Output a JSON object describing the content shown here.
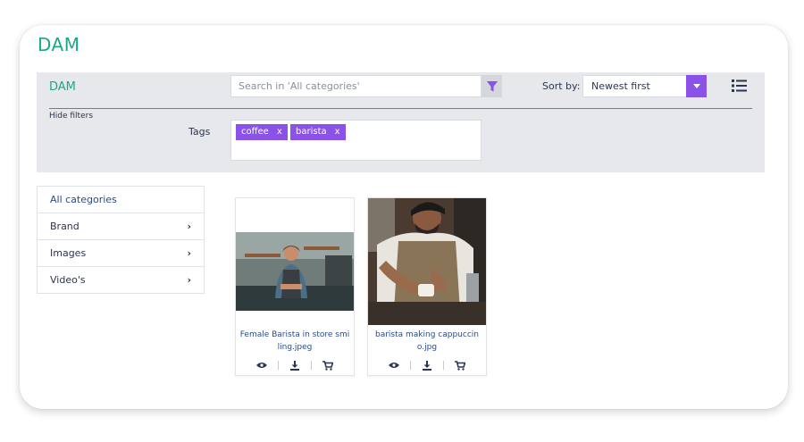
{
  "app": {
    "title": "DAM"
  },
  "toolbar": {
    "title": "DAM",
    "search_placeholder": "Search in 'All categories'",
    "sort_label": "Sort by:",
    "sort_value": "Newest first",
    "hide_filters": "Hide filters",
    "tags_label": "Tags",
    "tags": [
      {
        "label": "coffee",
        "remove": "x"
      },
      {
        "label": "barista",
        "remove": "x"
      }
    ]
  },
  "categories": [
    {
      "label": "All categories",
      "has_children": false
    },
    {
      "label": "Brand",
      "has_children": true
    },
    {
      "label": "Images",
      "has_children": true
    },
    {
      "label": "Video's",
      "has_children": true
    }
  ],
  "assets": [
    {
      "name": "Female Barista in store smiling.jpeg",
      "actions": [
        "eye-icon",
        "download-icon",
        "cart-icon"
      ]
    },
    {
      "name": "barista making cappuccino.jpg",
      "actions": [
        "eye-icon",
        "download-icon",
        "cart-icon"
      ]
    }
  ],
  "colors": {
    "accent_green": "#1aa88a",
    "accent_purple": "#8b52ea",
    "toolbar_bg": "#e6e8ec"
  }
}
